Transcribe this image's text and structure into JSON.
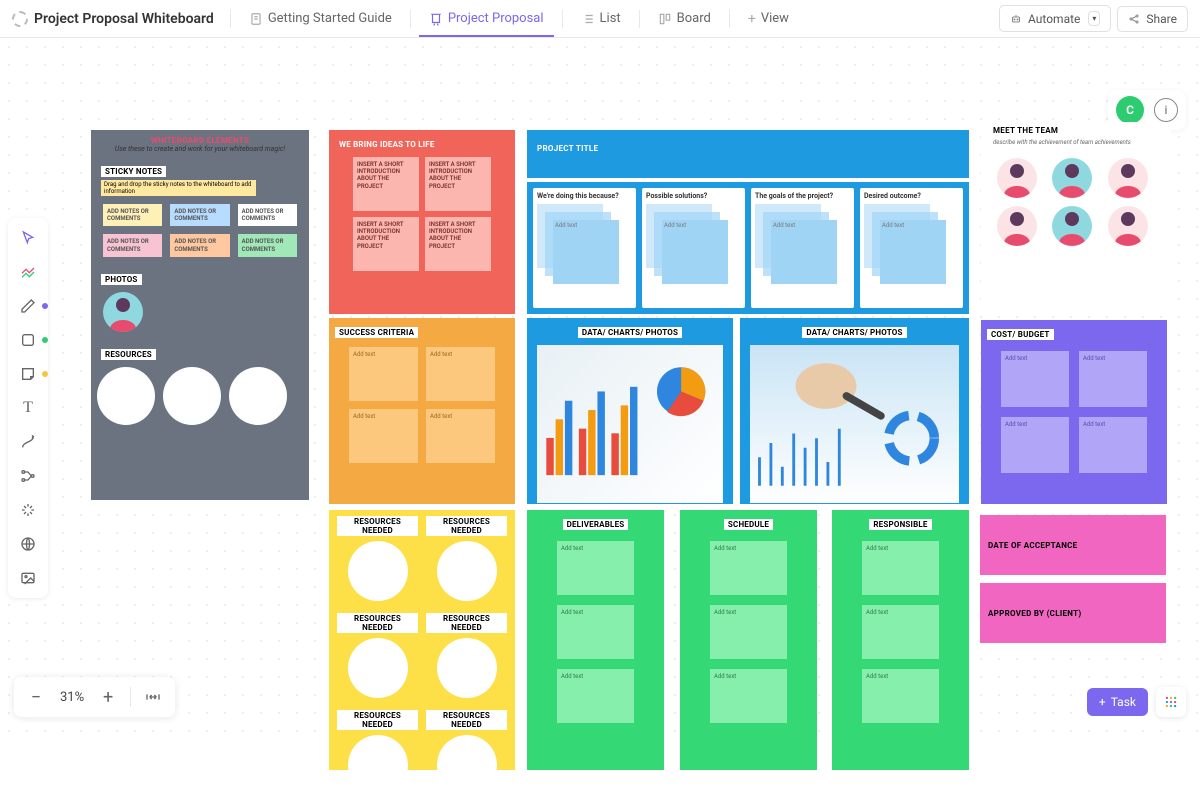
{
  "header": {
    "title": "Project Proposal Whiteboard",
    "tabs": {
      "getting_started": "Getting Started Guide",
      "project_proposal": "Project Proposal",
      "list": "List",
      "board": "Board",
      "view": "View"
    },
    "automate": "Automate",
    "share": "Share"
  },
  "user": {
    "initial": "C"
  },
  "zoom": {
    "value": "31%"
  },
  "bottom": {
    "task": "Task"
  },
  "wb": {
    "elements_title": "WHITEBOARD ELEMENTS",
    "elements_sub": "Use these to create and work for your whiteboard magic!",
    "sticky_label": "STICKY NOTES",
    "sticky_hint": "Drag and drop the sticky notes to the whiteboard to add information",
    "note_text": "ADD NOTES OR COMMENTS",
    "photos_label": "PHOTOS",
    "resources_label": "RESOURCES",
    "ideas_title": "WE BRING IDEAS TO LIFE",
    "intro_text": "INSERT A SHORT INTRODUCTION ABOUT THE PROJECT",
    "project_title": "PROJECT TITLE",
    "col1": "We're doing this because?",
    "col2": "Possible solutions?",
    "col3": "The goals of the project?",
    "col4": "Desired outcome?",
    "addtext": "Add text",
    "success": "SUCCESS CRITERIA",
    "data_charts": "DATA/ CHARTS/ PHOTOS",
    "team_title": "MEET THE TEAM",
    "team_sub": "describe with the achievement of team achievements",
    "cost": "COST/ BUDGET",
    "resneeded": "RESOURCES NEEDED",
    "deliverables": "DELIVERABLES",
    "schedule": "SCHEDULE",
    "responsible": "RESPONSIBLE",
    "acceptance": "DATE OF ACCEPTANCE",
    "approved": "APPROVED BY (CLIENT)"
  }
}
